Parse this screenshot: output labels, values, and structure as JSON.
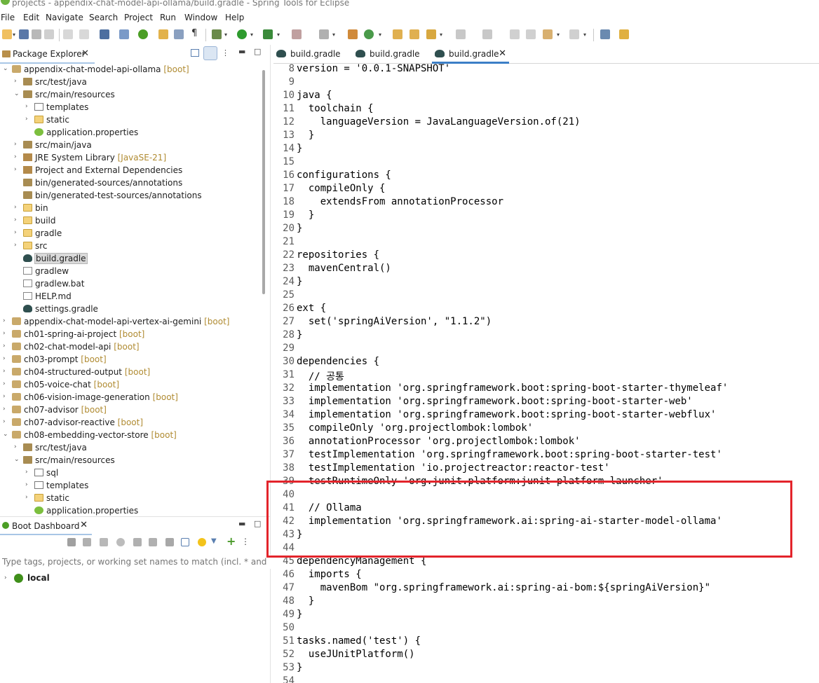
{
  "window": {
    "title": "projects - appendix-chat-model-api-ollama/build.gradle - Spring Tools for Eclipse"
  },
  "menu": [
    "File",
    "Edit",
    "Navigate",
    "Search",
    "Project",
    "Run",
    "Window",
    "Help"
  ],
  "package_explorer": {
    "title": "Package Explorer",
    "tree": [
      {
        "label": "appendix-chat-model-api-ollama",
        "decoration": "[boot]",
        "icon": "project-icon",
        "expanded": true
      },
      {
        "label": "src/test/java",
        "icon": "source-folder-icon",
        "expanded": false
      },
      {
        "label": "src/main/resources",
        "icon": "source-folder-icon",
        "expanded": true
      },
      {
        "label": "templates",
        "icon": "package-icon",
        "expanded": false
      },
      {
        "label": "static",
        "icon": "folder-icon",
        "expanded": false
      },
      {
        "label": "application.properties",
        "icon": "properties-icon"
      },
      {
        "label": "src/main/java",
        "icon": "source-folder-icon",
        "expanded": false
      },
      {
        "label": "JRE System Library",
        "decoration": "[JavaSE-21]",
        "icon": "library-icon",
        "expanded": false
      },
      {
        "label": "Project and External Dependencies",
        "icon": "library-icon",
        "expanded": false
      },
      {
        "label": "bin/generated-sources/annotations",
        "icon": "source-folder-icon"
      },
      {
        "label": "bin/generated-test-sources/annotations",
        "icon": "source-folder-icon"
      },
      {
        "label": "bin",
        "icon": "folder-icon",
        "expanded": false
      },
      {
        "label": "build",
        "icon": "folder-icon",
        "expanded": false
      },
      {
        "label": "gradle",
        "icon": "folder-icon",
        "expanded": false
      },
      {
        "label": "src",
        "icon": "folder-icon",
        "expanded": false
      },
      {
        "label": "build.gradle",
        "icon": "gradle-icon",
        "selected": true
      },
      {
        "label": "gradlew",
        "icon": "file-icon"
      },
      {
        "label": "gradlew.bat",
        "icon": "file-icon"
      },
      {
        "label": "HELP.md",
        "icon": "file-icon"
      },
      {
        "label": "settings.gradle",
        "icon": "gradle-icon"
      },
      {
        "label": "appendix-chat-model-api-vertex-ai-gemini",
        "decoration": "[boot]",
        "icon": "project-icon",
        "expanded": false
      },
      {
        "label": "ch01-spring-ai-project",
        "decoration": "[boot]",
        "icon": "project-icon",
        "expanded": false
      },
      {
        "label": "ch02-chat-model-api",
        "decoration": "[boot]",
        "icon": "project-icon",
        "expanded": false
      },
      {
        "label": "ch03-prompt",
        "decoration": "[boot]",
        "icon": "project-icon",
        "expanded": false
      },
      {
        "label": "ch04-structured-output",
        "decoration": "[boot]",
        "icon": "project-icon",
        "expanded": false
      },
      {
        "label": "ch05-voice-chat",
        "decoration": "[boot]",
        "icon": "project-icon",
        "expanded": false
      },
      {
        "label": "ch06-vision-image-generation",
        "decoration": "[boot]",
        "icon": "project-icon",
        "expanded": false
      },
      {
        "label": "ch07-advisor",
        "decoration": "[boot]",
        "icon": "project-icon",
        "expanded": false
      },
      {
        "label": "ch07-advisor-reactive",
        "decoration": "[boot]",
        "icon": "project-icon",
        "expanded": false
      },
      {
        "label": "ch08-embedding-vector-store",
        "decoration": "[boot]",
        "icon": "project-icon",
        "expanded": true
      },
      {
        "label": "src/test/java",
        "icon": "source-folder-icon",
        "expanded": false
      },
      {
        "label": "src/main/resources",
        "icon": "source-folder-icon",
        "expanded": true
      },
      {
        "label": "sql",
        "icon": "package-icon",
        "expanded": false
      },
      {
        "label": "templates",
        "icon": "package-icon",
        "expanded": false
      },
      {
        "label": "static",
        "icon": "folder-icon",
        "expanded": false
      },
      {
        "label": "application.properties",
        "icon": "properties-icon"
      }
    ]
  },
  "boot_dashboard": {
    "title": "Boot Dashboard",
    "filter_placeholder": "Type tags, projects, or working set names to match (incl. * and ? wilc",
    "node": "local"
  },
  "editor": {
    "tabs": [
      {
        "label": "build.gradle",
        "active": false
      },
      {
        "label": "build.gradle",
        "active": false
      },
      {
        "label": "build.gradle",
        "active": true
      }
    ],
    "lines": [
      {
        "n": "8",
        "text": "version = '0.0.1-SNAPSHOT'"
      },
      {
        "n": "9",
        "text": ""
      },
      {
        "n": "10",
        "text": "java {"
      },
      {
        "n": "11",
        "text": "  toolchain {"
      },
      {
        "n": "12",
        "text": "    languageVersion = JavaLanguageVersion.of(21)"
      },
      {
        "n": "13",
        "text": "  }"
      },
      {
        "n": "14",
        "text": "}"
      },
      {
        "n": "15",
        "text": ""
      },
      {
        "n": "16",
        "text": "configurations {"
      },
      {
        "n": "17",
        "text": "  compileOnly {"
      },
      {
        "n": "18",
        "text": "    extendsFrom annotationProcessor"
      },
      {
        "n": "19",
        "text": "  }"
      },
      {
        "n": "20",
        "text": "}"
      },
      {
        "n": "21",
        "text": ""
      },
      {
        "n": "22",
        "text": "repositories {"
      },
      {
        "n": "23",
        "text": "  mavenCentral()"
      },
      {
        "n": "24",
        "text": "}"
      },
      {
        "n": "25",
        "text": ""
      },
      {
        "n": "26",
        "text": "ext {"
      },
      {
        "n": "27",
        "text": "  set('springAiVersion', \"1.1.2\")"
      },
      {
        "n": "28",
        "text": "}"
      },
      {
        "n": "29",
        "text": ""
      },
      {
        "n": "30",
        "text": "dependencies {"
      },
      {
        "n": "31",
        "text": "  // 공통"
      },
      {
        "n": "32",
        "text": "  implementation 'org.springframework.boot:spring-boot-starter-thymeleaf'"
      },
      {
        "n": "33",
        "text": "  implementation 'org.springframework.boot:spring-boot-starter-web'"
      },
      {
        "n": "34",
        "text": "  implementation 'org.springframework.boot:spring-boot-starter-webflux'"
      },
      {
        "n": "35",
        "text": "  compileOnly 'org.projectlombok:lombok'"
      },
      {
        "n": "36",
        "text": "  annotationProcessor 'org.projectlombok:lombok'"
      },
      {
        "n": "37",
        "text": "  testImplementation 'org.springframework.boot:spring-boot-starter-test'"
      },
      {
        "n": "38",
        "text": "  testImplementation 'io.projectreactor:reactor-test'"
      },
      {
        "n": "39",
        "text": "  testRuntimeOnly 'org.junit.platform:junit-platform-launcher'"
      },
      {
        "n": "40",
        "text": ""
      },
      {
        "n": "41",
        "text": "  // Ollama"
      },
      {
        "n": "42",
        "text": "  implementation 'org.springframework.ai:spring-ai-starter-model-ollama'"
      },
      {
        "n": "43",
        "text": "}"
      },
      {
        "n": "44",
        "text": ""
      },
      {
        "n": "45",
        "text": "dependencyManagement {"
      },
      {
        "n": "46",
        "text": "  imports {"
      },
      {
        "n": "47",
        "text": "    mavenBom \"org.springframework.ai:spring-ai-bom:${springAiVersion}\""
      },
      {
        "n": "48",
        "text": "  }"
      },
      {
        "n": "49",
        "text": "}"
      },
      {
        "n": "50",
        "text": ""
      },
      {
        "n": "51",
        "text": "tasks.named('test') {"
      },
      {
        "n": "52",
        "text": "  useJUnitPlatform()"
      },
      {
        "n": "53",
        "text": "}"
      },
      {
        "n": "54",
        "text": ""
      }
    ]
  },
  "colors": {
    "highlight": "#e3242b",
    "boot_green": "#6db33f",
    "decoration": "#b08b32",
    "active_tab": "#3c7fc7"
  }
}
